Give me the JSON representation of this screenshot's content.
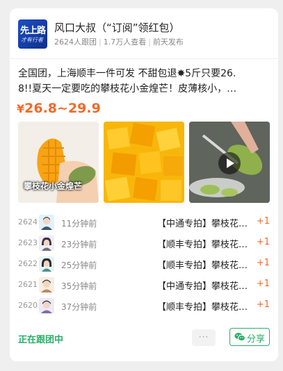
{
  "header": {
    "avatar_text_top": "先上路",
    "avatar_text_bottom": "才有行者",
    "title": "风口大叔（“订阅”领红包）",
    "followers": "2624人跟团",
    "views": "1.7万人查看",
    "posted": "前天发布"
  },
  "post": {
    "description_line1": "全国团，上海顺丰一件可发 不甜包退✸5斤只要26.",
    "description_line2": "8!!夏天一定要吃的攀枝花小金煌芒！皮薄核小，…",
    "price_currency": "¥",
    "price_range": "26.8~29.9"
  },
  "photos": [
    {
      "caption": "攀枝花小金煌芒",
      "icon": "mango-hand-photo"
    },
    {
      "caption": "",
      "icon": "mango-cubes-photo"
    },
    {
      "caption": "",
      "icon": "mango-cutting-video"
    }
  ],
  "orders": [
    {
      "num": "2624",
      "time": "11分钟前",
      "product": "【中通专拍】攀枝花小金煌芒",
      "count": "+1",
      "avatar_bg": "#e3f1fb",
      "avatar_fg": "#3b5a73"
    },
    {
      "num": "2623",
      "time": "23分钟前",
      "product": "【顺丰专拍】攀枝花小金煌芒",
      "count": "+1",
      "avatar_bg": "#f2ecf7",
      "avatar_fg": "#3a3248"
    },
    {
      "num": "2622",
      "time": "25分钟前",
      "product": "【顺丰专拍】攀枝花小金煌芒",
      "count": "+1",
      "avatar_bg": "#e6f4f4",
      "avatar_fg": "#2b2f35"
    },
    {
      "num": "2621",
      "time": "35分钟前",
      "product": "【中通专拍】攀枝花小金煌芒",
      "count": "+1",
      "avatar_bg": "#f7eee4",
      "avatar_fg": "#5a4030"
    },
    {
      "num": "2620",
      "time": "37分钟前",
      "product": "【顺丰专拍】攀枝花小金煌芒",
      "count": "+1",
      "avatar_bg": "#ede9f7",
      "avatar_fg": "#3a3450"
    }
  ],
  "footer": {
    "status": "正在跟团中",
    "more": "···",
    "share_label": "分享"
  },
  "colors": {
    "accent_orange": "#f06a2b",
    "accent_green": "#2aae67"
  }
}
